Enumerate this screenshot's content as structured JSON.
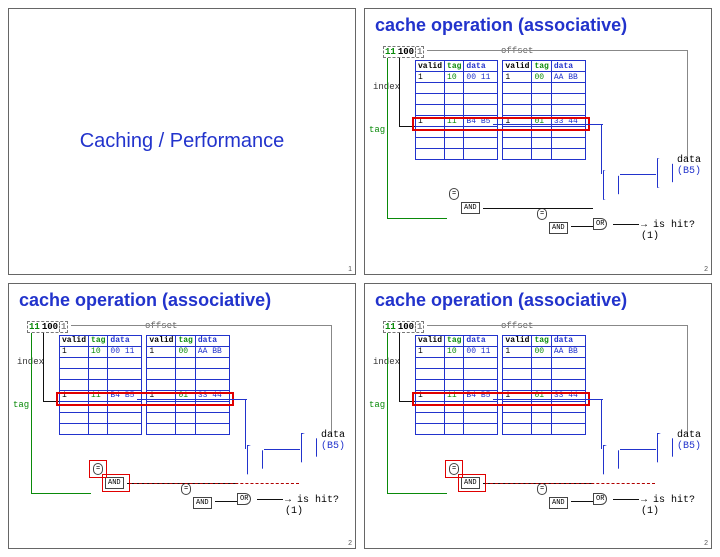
{
  "slides": {
    "title": "Caching / Performance",
    "heading": "cache operation (associative)",
    "pagenums": {
      "s1": "1",
      "s2": "2",
      "s3": "2",
      "s4": "2"
    }
  },
  "addr": {
    "tag": "11",
    "index": "100",
    "offset": "1"
  },
  "labels": {
    "offset": "offset",
    "index": "index",
    "tag": "tag",
    "valid": "valid",
    "tag_col": "tag",
    "data_col": "data",
    "and": "AND",
    "or": "OR",
    "eq": "=",
    "is_hit": "is hit? (1)",
    "data_out": "data",
    "data_val": "(B5)"
  },
  "way0": {
    "r0": {
      "v": "1",
      "t": "10",
      "d": "00 11"
    },
    "hit": {
      "v": "1",
      "t": "11",
      "d": "B4 B5"
    }
  },
  "way1": {
    "r0": {
      "v": "1",
      "t": "00",
      "d": "AA BB"
    },
    "hit": {
      "v": "1",
      "t": "01",
      "d": "33 44"
    }
  }
}
